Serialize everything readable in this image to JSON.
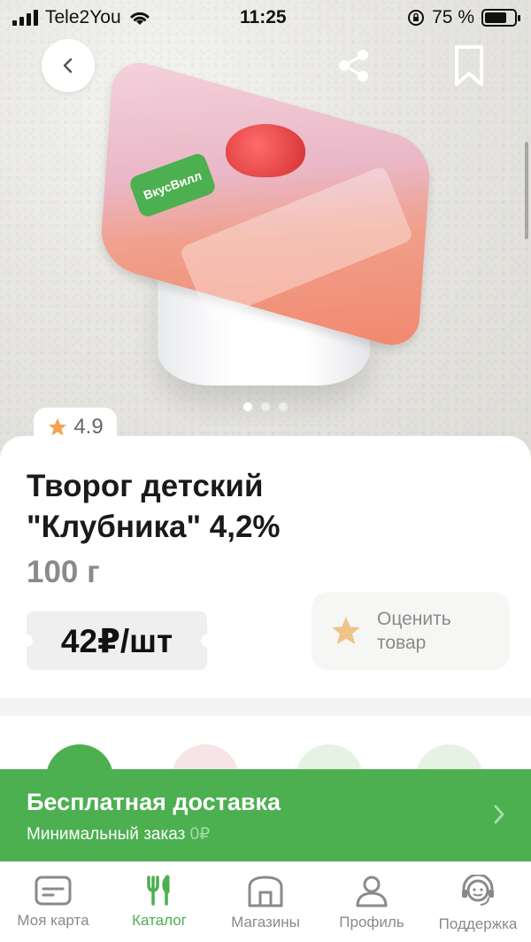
{
  "status_bar": {
    "carrier": "Tele2You",
    "time": "11:25",
    "battery_percent": "75 %",
    "battery_level": 0.75
  },
  "product": {
    "rating": "4.9",
    "title_line1": "Творог детский",
    "title_line2": "\"Клубника\" 4,2%",
    "weight": "100 г",
    "price": "42₽/шт",
    "rate_label_line1": "Оценить",
    "rate_label_line2": "товар",
    "lid_brand": "ВкусВилл"
  },
  "carousel": {
    "dots": 3,
    "active_index": 0
  },
  "delivery": {
    "title": "Бесплатная доставка",
    "subtitle": "Минимальный заказ",
    "min_order": "0₽"
  },
  "tabbar": {
    "items": [
      {
        "label": "Моя карта",
        "icon": "card-icon"
      },
      {
        "label": "Каталог",
        "icon": "fork-knife-icon"
      },
      {
        "label": "Магазины",
        "icon": "store-icon"
      },
      {
        "label": "Профиль",
        "icon": "person-icon"
      },
      {
        "label": "Поддержка",
        "icon": "support-icon"
      }
    ],
    "active_index": 1
  },
  "colors": {
    "brand_green": "#4caf50",
    "star_orange": "#f2a550",
    "text_dark": "#1a1a1a",
    "text_muted": "#8a8a8a"
  }
}
